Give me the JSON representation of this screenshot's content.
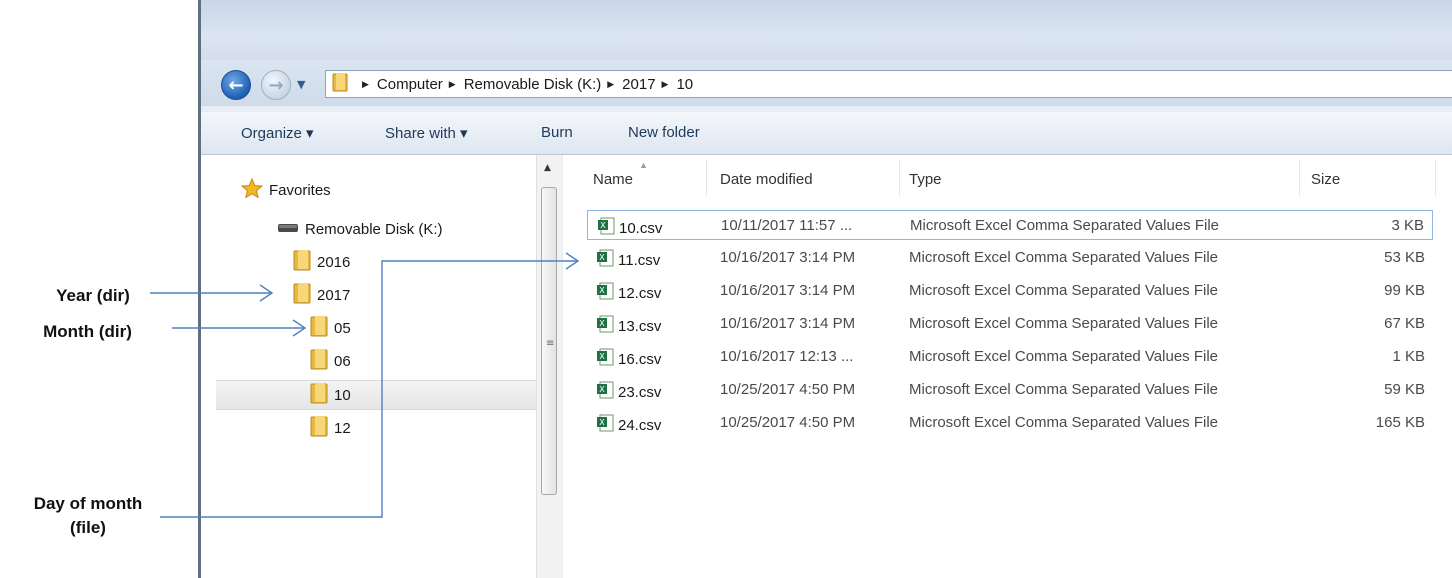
{
  "address": {
    "crumbs": [
      "Computer",
      "Removable Disk (K:)",
      "2017",
      "10"
    ]
  },
  "toolbar": {
    "organize": "Organize ▾",
    "share_with": "Share with ▾",
    "burn": "Burn",
    "new_folder": "New folder"
  },
  "nav": {
    "favorites": "Favorites",
    "drive": "Removable Disk (K:)",
    "folders": {
      "y2016": "2016",
      "y2017": "2017",
      "m05": "05",
      "m06": "06",
      "m10": "10",
      "m12": "12"
    },
    "selected": "10"
  },
  "columns": {
    "name": "Name",
    "date": "Date modified",
    "type": "Type",
    "size": "Size"
  },
  "files": [
    {
      "name": "10.csv",
      "date": "10/11/2017 11:57 ...",
      "type": "Microsoft Excel Comma Separated Values File",
      "size": "3 KB"
    },
    {
      "name": "11.csv",
      "date": "10/16/2017 3:14 PM",
      "type": "Microsoft Excel Comma Separated Values File",
      "size": "53 KB"
    },
    {
      "name": "12.csv",
      "date": "10/16/2017 3:14 PM",
      "type": "Microsoft Excel Comma Separated Values File",
      "size": "99 KB"
    },
    {
      "name": "13.csv",
      "date": "10/16/2017 3:14 PM",
      "type": "Microsoft Excel Comma Separated Values File",
      "size": "67 KB"
    },
    {
      "name": "16.csv",
      "date": "10/16/2017 12:13 ...",
      "type": "Microsoft Excel Comma Separated Values File",
      "size": "1 KB"
    },
    {
      "name": "23.csv",
      "date": "10/25/2017 4:50 PM",
      "type": "Microsoft Excel Comma Separated Values File",
      "size": "59 KB"
    },
    {
      "name": "24.csv",
      "date": "10/25/2017 4:50 PM",
      "type": "Microsoft Excel Comma Separated Values File",
      "size": "165 KB"
    }
  ],
  "annotations": {
    "year": "Year (dir)",
    "month": "Month (dir)",
    "day_line1": "Day of month",
    "day_line2": "(file)"
  },
  "colors": {
    "arrow": "#4f81bd",
    "folder": "#e8b940",
    "excel_green": "#1e7145"
  }
}
